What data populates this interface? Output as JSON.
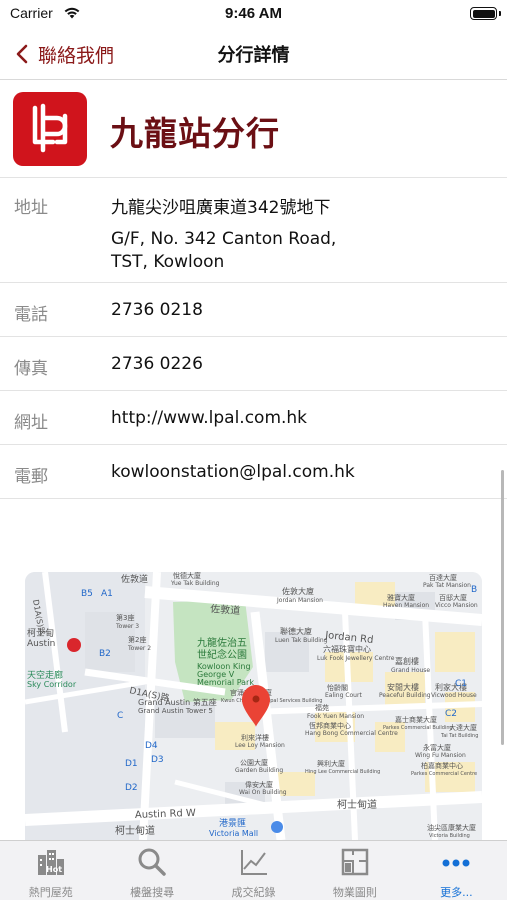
{
  "status_bar": {
    "carrier": "Carrier",
    "time": "9:46 AM"
  },
  "nav": {
    "back_label": "聯絡我們",
    "title": "分行詳情"
  },
  "branch": {
    "name": "九龍站分行"
  },
  "details": {
    "address": {
      "label": "地址",
      "value_zh": "九龍尖沙咀廣東道342號地下",
      "value_en_line1": "G/F, No. 342 Canton Road,",
      "value_en_line2": "TST, Kowloon"
    },
    "phone": {
      "label": "電話",
      "value": "2736 0218"
    },
    "fax": {
      "label": "傳真",
      "value": "2736 0226"
    },
    "website": {
      "label": "網址",
      "value": "http://www.lpal.com.hk"
    },
    "email": {
      "label": "電郵",
      "value": "kowloonstation@lpal.com.hk"
    }
  },
  "map": {
    "labels": {
      "jordan_rd_zh": "佐敦道",
      "jordan_rd_en": "Jordan Rd",
      "austin_rd": "Austin Rd W",
      "austin_rd_zh": "柯士甸道",
      "austin_station_zh": "柯士甸",
      "austin_station_en": "Austin",
      "sky_corridor_zh": "天空走廊",
      "sky_corridor_en": "Sky Corridor",
      "park_zh_1": "九龍佐治五",
      "park_zh_2": "世紀念公園",
      "park_en_1": "Kowloon King",
      "park_en_2": "George V",
      "park_en_3": "Memorial Park",
      "grand_austin_zh": "Grand Austin 第五座",
      "grand_austin_en": "Grand Austin Tower 5",
      "victoria_mall_zh": "港景匯",
      "victoria_mall_en": "Victoria Mall",
      "d1a_zh": "D1A(S)路",
      "jordan_mansion_zh": "佐敦大廈",
      "jordan_mansion_en": "Jordan Mansion",
      "yuet_tak_zh": "悅德大廈",
      "yuet_tak_en": "Yue Tak Building",
      "luen_tak_zh": "聯德大廈",
      "luen_tak_en": "Luen Tak Building",
      "luk_fook_zh": "六福珠寶中心",
      "luk_fook_en": "Luk Fook Jewellery Centre",
      "fook_yuen_zh": "福苑",
      "fook_yuen_en": "Fook Yuen Mansion",
      "ealing_zh": "怡齡閣",
      "ealing_en": "Ealing Court",
      "kwun_chung_zh": "官涌市政大廈",
      "kwun_chung_en": "Kwun Chung Municipal Services Building",
      "lee_loy_zh": "利來洋樓",
      "lee_loy_en": "Lee Loy Mansion",
      "garden_zh": "公園大廈",
      "garden_en": "Garden Building",
      "wai_on_zh": "偉安大廈",
      "wai_on_en": "Wai On Building",
      "hang_bong_zh": "恆邦商業中心",
      "hang_bong_en": "Hang Bong Commercial Centre",
      "hing_lee_zh": "興利大廈",
      "hing_lee_en": "Hing Lee Commercial Building",
      "peaceful_zh": "安閒大樓",
      "peaceful_en": "Peaceful Building",
      "grand_house_zh": "嘉創樓",
      "grand_house_en": "Grand House",
      "vicwood_zh": "利家大樓",
      "vicwood_en": "Vicwood House",
      "parkes_zh": "嘉士商業大廈",
      "parkes_en": "Parkes Commercial Building",
      "wing_fu_zh": "永富大廈",
      "wing_fu_en": "Wing Fu Mansion",
      "parkes_comm_zh": "柏嘉商業中心",
      "parkes_comm_en": "Parkes Commercial Centre",
      "haven_zh": "雅寶大廈",
      "haven_en": "Haven Mansion",
      "vicco_zh": "百邸大廈",
      "vicco_en": "Vicco Mansion",
      "pak_tat_zh": "百達大廈",
      "pak_tat_en": "Pak Tat Mansion",
      "tai_tat_zh": "大達大廈",
      "tai_tat_en": "Tai Tat Building",
      "tower3_zh": "第3座",
      "tower3_en": "Tower 3",
      "tower2_zh": "第2座",
      "tower2_en": "Tower 2",
      "d2a_zh": "D1A(S)路",
      "victoria_bldg_zh": "油尖區康業大廈",
      "victoria_bldg_en": "Victoria Building",
      "exit_b5": "B5",
      "exit_a1": "A1",
      "exit_b2": "B2",
      "exit_c": "C",
      "exit_d4": "D4",
      "exit_d3": "D3",
      "exit_d1": "D1",
      "exit_d2": "D2",
      "exit_c1": "C1",
      "exit_c2": "C2",
      "exit_b": "B"
    }
  },
  "tabs": [
    {
      "label": "熱門屋苑",
      "icon": "buildings-icon",
      "active": false
    },
    {
      "label": "樓盤搜尋",
      "icon": "search-icon",
      "active": false
    },
    {
      "label": "成交紀錄",
      "icon": "chart-icon",
      "active": false
    },
    {
      "label": "物業圖則",
      "icon": "floorplan-icon",
      "active": false
    },
    {
      "label": "更多...",
      "icon": "more-icon",
      "active": true
    }
  ],
  "colors": {
    "brand_red": "#d0141c",
    "accent_dark_red": "#8b1a1a",
    "tab_active_blue": "#1470d6"
  }
}
